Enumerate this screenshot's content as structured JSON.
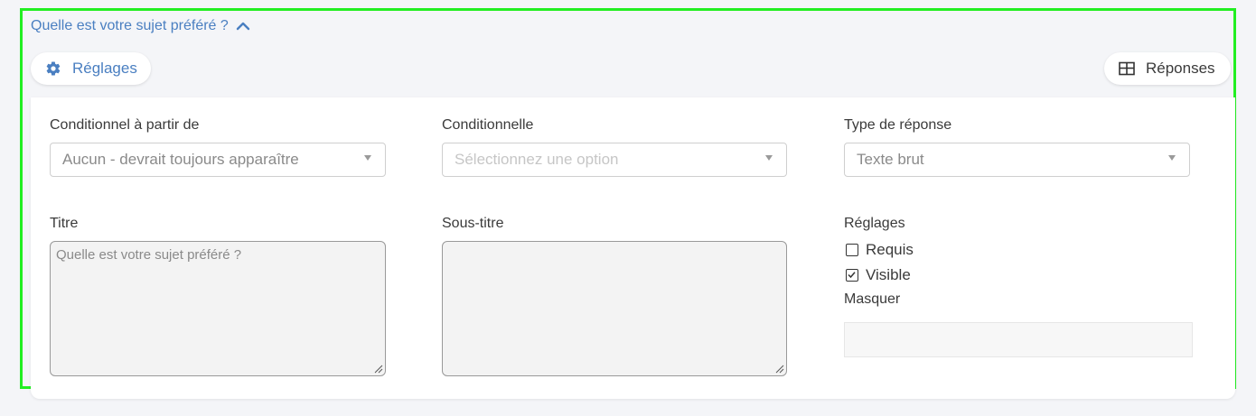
{
  "question": {
    "title": "Quelle est votre sujet préféré ?",
    "collapse_icon": "chevron-up-icon"
  },
  "toolbar": {
    "settings_label": "Réglages",
    "settings_icon": "gear-icon",
    "answers_label": "Réponses",
    "answers_icon": "table-icon"
  },
  "form": {
    "conditional_from": {
      "label": "Conditionnel à partir de",
      "value": "Aucun - devrait toujours apparaître"
    },
    "conditional": {
      "label": "Conditionnelle",
      "placeholder": "Sélectionnez une option"
    },
    "response_type": {
      "label": "Type de réponse",
      "value": "Texte brut"
    },
    "title": {
      "label": "Titre",
      "placeholder": "Quelle est votre sujet préféré ?"
    },
    "subtitle": {
      "label": "Sous-titre",
      "placeholder": ""
    },
    "settings": {
      "label": "Réglages",
      "required_label": "Requis",
      "required_checked": false,
      "visible_label": "Visible",
      "visible_checked": true,
      "hide_label": "Masquer",
      "hide_value": ""
    }
  },
  "colors": {
    "accent": "#4a7fc1",
    "highlight_border": "#22ee22",
    "background": "#f4f5f8"
  }
}
